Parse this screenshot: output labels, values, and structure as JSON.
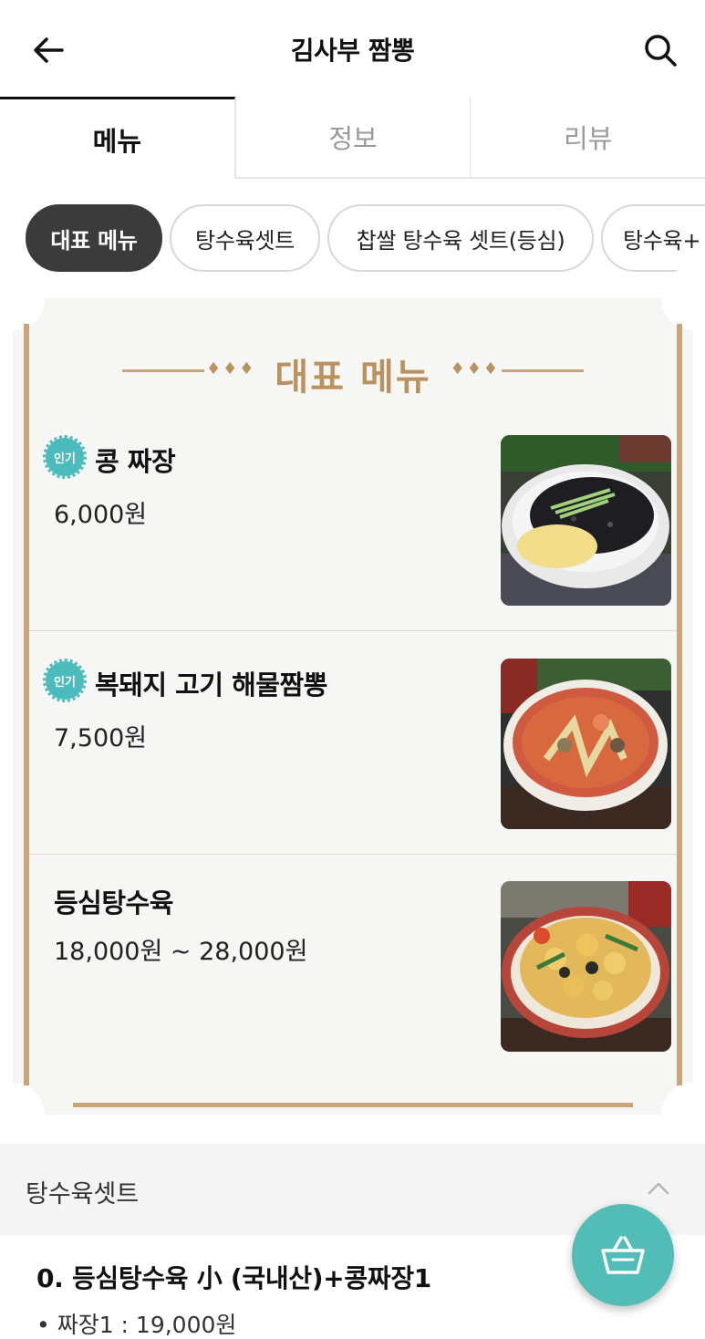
{
  "header": {
    "title": "김사부 짬뽕"
  },
  "tabs": [
    {
      "label": "메뉴",
      "active": true
    },
    {
      "label": "정보",
      "active": false
    },
    {
      "label": "리뷰",
      "active": false
    }
  ],
  "chips": [
    {
      "label": "대표 메뉴",
      "active": true
    },
    {
      "label": "탕수육셋트",
      "active": false
    },
    {
      "label": "찹쌀 탕수육 셋트(등심)",
      "active": false
    },
    {
      "label": "탕수육+",
      "active": false
    }
  ],
  "featured": {
    "title": "대표 메뉴",
    "ornament": "♦♦♦",
    "badge_label": "인기",
    "items": [
      {
        "name": "콩 짜장",
        "price": "6,000원",
        "popular": true,
        "image": "jajangmyeon"
      },
      {
        "name": "복돼지 고기 해물짬뽕",
        "price": "7,500원",
        "popular": true,
        "image": "jjamppong"
      },
      {
        "name": "등심탕수육",
        "price": "18,000원 ~ 28,000원",
        "popular": false,
        "image": "tangsuyuk"
      }
    ]
  },
  "section": {
    "title": "탕수육셋트",
    "first_item": {
      "name": "0. 등심탕수육 小  (국내산)+콩짜장1",
      "detail": "• 짜장1 : 19,000원"
    }
  },
  "colors": {
    "accent_teal": "#52bdb6",
    "gold": "#c9a67a",
    "chip_active": "#3b3b3b"
  }
}
